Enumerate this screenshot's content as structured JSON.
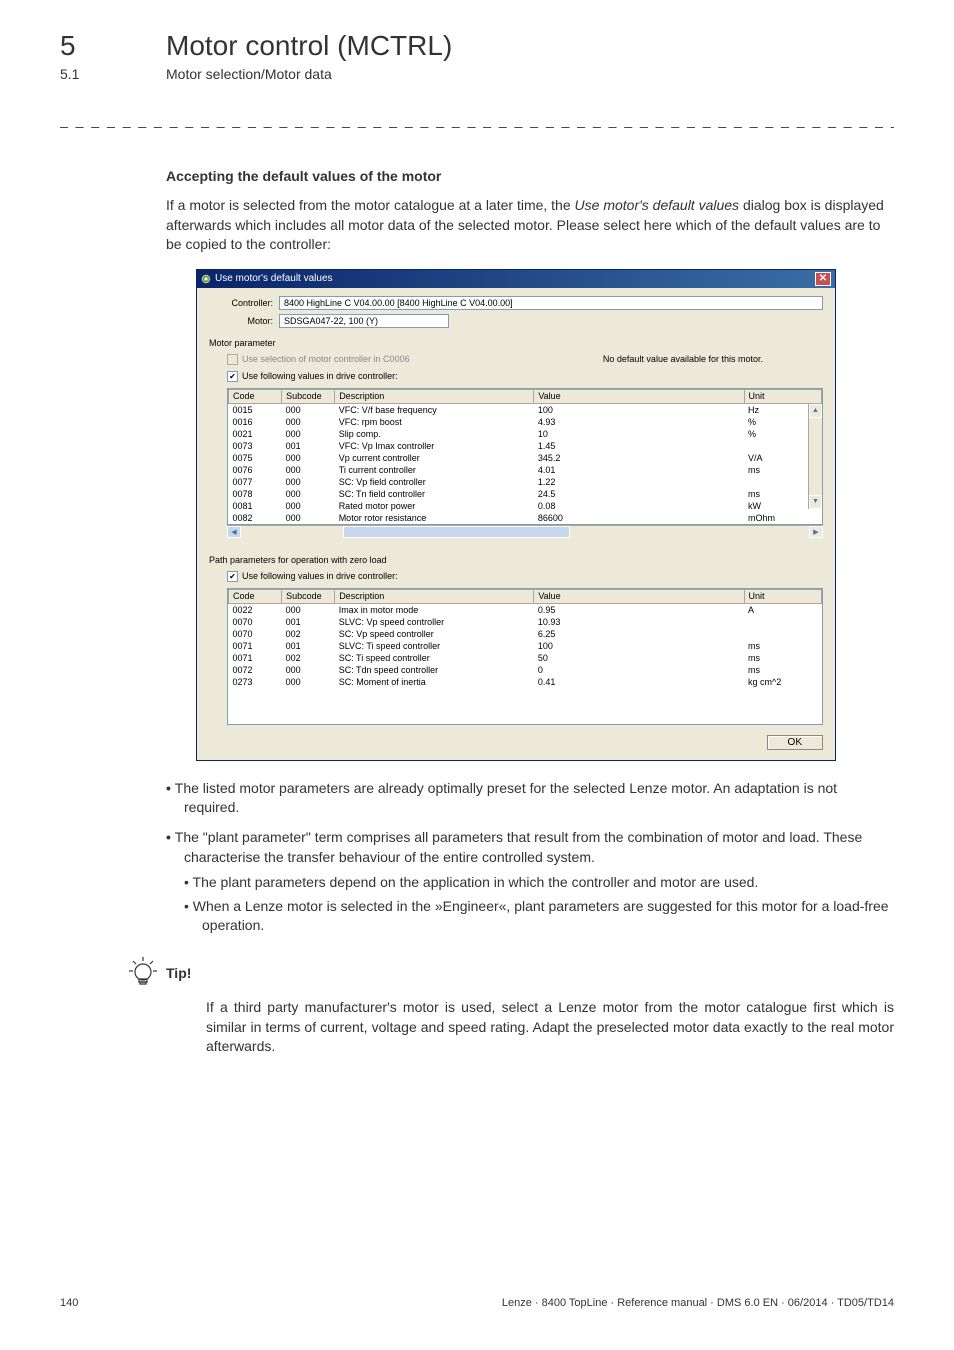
{
  "header": {
    "chapter_num": "5",
    "chapter_title": "Motor control (MCTRL)",
    "section_num": "5.1",
    "section_title": "Motor selection/Motor data",
    "dash_line": "_ _ _ _ _ _ _ _ _ _ _ _ _ _ _ _ _ _ _ _ _ _ _ _ _ _ _ _ _ _ _ _ _ _ _ _ _ _ _ _ _ _ _ _ _ _ _ _ _ _ _ _ _ _ _ _ _ _ _ _ _ _ _ _"
  },
  "section": {
    "heading": "Accepting the default values of the motor",
    "para_prefix": "If a motor is selected from the motor catalogue at a later time, the ",
    "para_em": "Use motor's default values",
    "para_suffix": " dialog box is displayed afterwards which includes all motor data of the selected motor. Please select here which of the default values are to be copied to the controller:"
  },
  "dialog": {
    "title": "Use motor's default values",
    "controller_label": "Controller:",
    "controller_value": "8400 HighLine C V04.00.00 [8400 HighLine C V04.00.00]",
    "motor_label": "Motor:",
    "motor_value": "SDSGA047-22, 100 (Y)",
    "motor_param_label": "Motor parameter",
    "cb1_label": "Use selection of motor controller in C0006",
    "no_default": "No default value available for this motor.",
    "cb2_label": "Use following values in drive controller:",
    "table1": {
      "headers": {
        "code": "Code",
        "subcode": "Subcode",
        "description": "Description",
        "value": "Value",
        "unit": "Unit"
      },
      "rows": [
        {
          "code": "0015",
          "sub": "000",
          "desc": "VFC: V/f base frequency",
          "val": "100",
          "unit": "Hz"
        },
        {
          "code": "0016",
          "sub": "000",
          "desc": "VFC: rpm boost",
          "val": "4.93",
          "unit": "%"
        },
        {
          "code": "0021",
          "sub": "000",
          "desc": "Slip comp.",
          "val": "10",
          "unit": "%"
        },
        {
          "code": "0073",
          "sub": "001",
          "desc": "VFC: Vp Imax controller",
          "val": "1.45",
          "unit": ""
        },
        {
          "code": "0075",
          "sub": "000",
          "desc": "Vp current controller",
          "val": "345.2",
          "unit": "V/A"
        },
        {
          "code": "0076",
          "sub": "000",
          "desc": "Ti current controller",
          "val": "4.01",
          "unit": "ms"
        },
        {
          "code": "0077",
          "sub": "000",
          "desc": "SC: Vp field controller",
          "val": "1.22",
          "unit": ""
        },
        {
          "code": "0078",
          "sub": "000",
          "desc": "SC: Tn field controller",
          "val": "24.5",
          "unit": "ms"
        },
        {
          "code": "0081",
          "sub": "000",
          "desc": "Rated motor power",
          "val": "0.08",
          "unit": "kW"
        },
        {
          "code": "0082",
          "sub": "000",
          "desc": "Motor rotor resistance",
          "val": "86600",
          "unit": "mOhm"
        }
      ]
    },
    "path_label": "Path parameters for operation with zero load",
    "cb3_label": "Use following values in drive controller:",
    "table2": {
      "headers": {
        "code": "Code",
        "subcode": "Subcode",
        "description": "Description",
        "value": "Value",
        "unit": "Unit"
      },
      "rows": [
        {
          "code": "0022",
          "sub": "000",
          "desc": "Imax in motor mode",
          "val": "0.95",
          "unit": "A"
        },
        {
          "code": "0070",
          "sub": "001",
          "desc": "SLVC: Vp speed controller",
          "val": "10.93",
          "unit": ""
        },
        {
          "code": "0070",
          "sub": "002",
          "desc": "SC: Vp speed controller",
          "val": "6.25",
          "unit": ""
        },
        {
          "code": "0071",
          "sub": "001",
          "desc": "SLVC: Ti speed controller",
          "val": "100",
          "unit": "ms"
        },
        {
          "code": "0071",
          "sub": "002",
          "desc": "SC: Ti speed controller",
          "val": "50",
          "unit": "ms"
        },
        {
          "code": "0072",
          "sub": "000",
          "desc": "SC: Tdn speed controller",
          "val": "0",
          "unit": "ms"
        },
        {
          "code": "0273",
          "sub": "000",
          "desc": "SC: Moment of inertia",
          "val": "0.41",
          "unit": "kg cm^2"
        },
        {
          "code": "",
          "sub": "",
          "desc": "",
          "val": "",
          "unit": ""
        },
        {
          "code": "",
          "sub": "",
          "desc": "",
          "val": "",
          "unit": ""
        },
        {
          "code": "",
          "sub": "",
          "desc": "",
          "val": "",
          "unit": ""
        }
      ]
    },
    "ok": "OK"
  },
  "bullets": {
    "b1": "The listed motor parameters are already optimally preset for the selected Lenze motor. An adaptation is not required.",
    "b2": "The \"plant parameter\" term comprises all parameters that result from the combination of motor and load. These characterise the transfer behaviour of the entire controlled system.",
    "b2a": "The plant parameters depend on the application in which the controller and motor are used.",
    "b2b": "When a Lenze motor is selected in the »Engineer«, plant parameters are suggested for this motor for a load-free operation."
  },
  "tip": {
    "label": "Tip!",
    "body": "If a third party manufacturer's motor is used, select a Lenze motor from the motor catalogue first which is similar in terms of current, voltage and speed rating. Adapt the preselected motor data exactly to the real motor afterwards."
  },
  "footer": {
    "page": "140",
    "ref": "Lenze · 8400 TopLine · Reference manual · DMS 6.0 EN · 06/2014 · TD05/TD14"
  }
}
